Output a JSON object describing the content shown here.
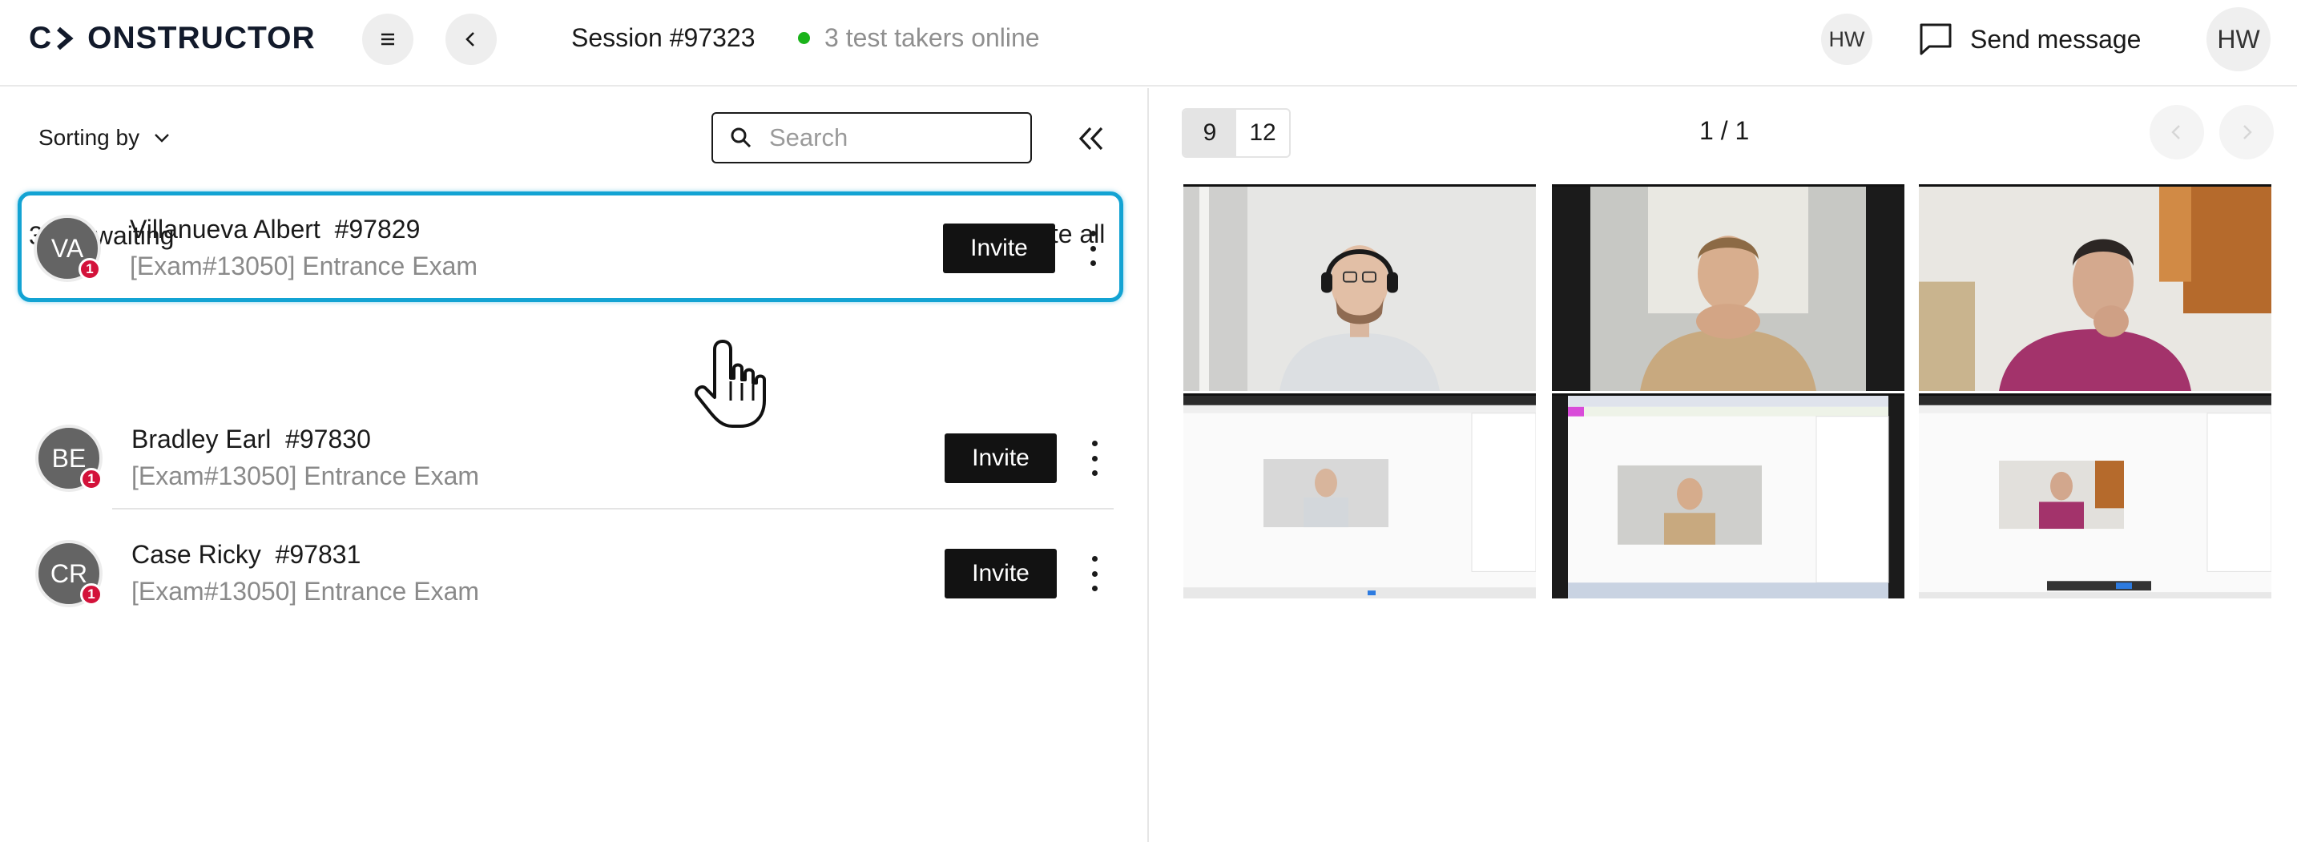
{
  "header": {
    "logo_text": "CONSTRUCTOR",
    "session_title": "Session #97323",
    "online_text": "3 test takers online",
    "online_color": "#1ab31a",
    "menu_icon": "hamburger-icon",
    "back_icon": "chevron-left-icon",
    "user_initials_small": "HW",
    "send_message_label": "Send message",
    "send_message_icon": "chat-bubble-icon",
    "user_initials": "HW"
  },
  "left": {
    "sorting_label": "Sorting by",
    "search": {
      "placeholder": "Search",
      "value": ""
    },
    "waiting_label": "3 are waiting",
    "invite_all_label": "Invite all",
    "accent_color": "#13a3d3",
    "people": [
      {
        "initials": "VA",
        "name": "Villanueva Albert  #97829",
        "exam": "[Exam#13050] Entrance Exam",
        "badge": "1",
        "invite_label": "Invite",
        "selected": true
      },
      {
        "initials": "BE",
        "name": "Bradley Earl  #97830",
        "exam": "[Exam#13050] Entrance Exam",
        "badge": "1",
        "invite_label": "Invite",
        "selected": false
      },
      {
        "initials": "CR",
        "name": "Case Ricky  #97831",
        "exam": "[Exam#13050] Entrance Exam",
        "badge": "1",
        "invite_label": "Invite",
        "selected": false
      }
    ]
  },
  "right": {
    "grid_options": [
      "9",
      "12"
    ],
    "grid_selected": "9",
    "page_counter": "1 / 1",
    "tiles": [
      {
        "kind": "camera",
        "person": "Villanueva Albert"
      },
      {
        "kind": "camera",
        "person": "Bradley Earl"
      },
      {
        "kind": "camera",
        "person": "Case Ricky"
      },
      {
        "kind": "screen",
        "person": "Villanueva Albert"
      },
      {
        "kind": "screen",
        "person": "Bradley Earl"
      },
      {
        "kind": "screen",
        "person": "Case Ricky"
      }
    ]
  }
}
